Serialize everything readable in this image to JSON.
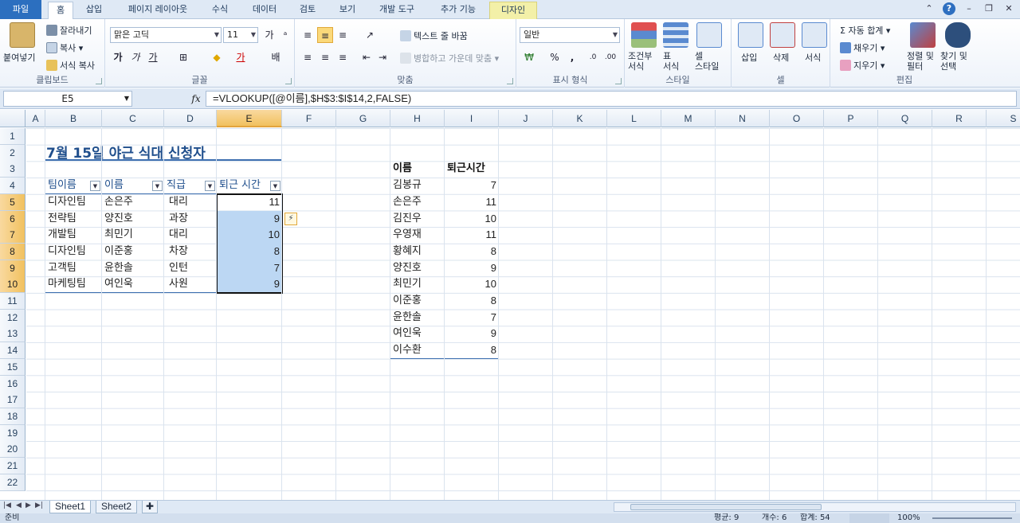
{
  "ribbon": {
    "tabs": [
      "파일",
      "홈",
      "삽입",
      "페이지 레이아웃",
      "수식",
      "데이터",
      "검토",
      "보기",
      "개발 도구",
      "추가 기능",
      "디자인"
    ],
    "clipboard": {
      "paste": "붙여넣기",
      "cut": "잘라내기",
      "copy": "복사",
      "format_painter": "서식 복사",
      "label": "클립보드"
    },
    "font": {
      "name": "맑은 고딕",
      "size": "11",
      "bold": "가",
      "italic": "가",
      "underline": "가",
      "label": "글꼴"
    },
    "alignment": {
      "wrap": "텍스트 줄 바꿈",
      "merge": "병합하고 가운데 맞춤",
      "label": "맞춤"
    },
    "number": {
      "format": "일반",
      "percent": "%",
      "comma": ",",
      "label": "표시 형식"
    },
    "styles": {
      "conditional": "조건부\n서식",
      "table": "표\n서식",
      "cell_style": "셀\n스타일",
      "label": "스타일"
    },
    "cells": {
      "insert": "삽입",
      "delete": "삭제",
      "format": "서식",
      "label": "셀"
    },
    "editing": {
      "autosum": "자동 합계",
      "fill": "채우기",
      "clear": "지우기",
      "sort": "정렬 및\n필터",
      "find": "찾기 및\n선택",
      "label": "편집"
    }
  },
  "formula_bar": {
    "name_box": "E5",
    "fx": "fx",
    "formula": "=VLOOKUP([@이름],$H$3:$I$14,2,FALSE)"
  },
  "columns": [
    "A",
    "B",
    "C",
    "D",
    "E",
    "F",
    "G",
    "H",
    "I",
    "J",
    "K",
    "L",
    "M",
    "N",
    "O",
    "P",
    "Q",
    "R",
    "S"
  ],
  "rows": [
    "1",
    "2",
    "3",
    "4",
    "5",
    "6",
    "7",
    "8",
    "9",
    "10",
    "11",
    "12",
    "13",
    "14",
    "15",
    "16",
    "17",
    "18",
    "19",
    "20",
    "21",
    "22"
  ],
  "sheet": {
    "title": "7월 15일 야근 식대 신청자",
    "table_headers": [
      "팀이름",
      "이름",
      "직급",
      "퇴근 시간"
    ],
    "table_rows": [
      [
        "디자인팀",
        "손은주",
        "대리",
        "11"
      ],
      [
        "전략팀",
        "양진호",
        "과장",
        "9"
      ],
      [
        "개발팀",
        "최민기",
        "대리",
        "10"
      ],
      [
        "디자인팀",
        "이준홍",
        "차장",
        "8"
      ],
      [
        "고객팀",
        "윤한솔",
        "인턴",
        "7"
      ],
      [
        "마케팅팀",
        "여인욱",
        "사원",
        "9"
      ]
    ],
    "lookup_headers": [
      "이름",
      "퇴근시간"
    ],
    "lookup_rows": [
      [
        "김봉규",
        "7"
      ],
      [
        "손은주",
        "11"
      ],
      [
        "김진우",
        "10"
      ],
      [
        "우영재",
        "11"
      ],
      [
        "황혜지",
        "8"
      ],
      [
        "양진호",
        "9"
      ],
      [
        "최민기",
        "10"
      ],
      [
        "이준홍",
        "8"
      ],
      [
        "윤한솔",
        "7"
      ],
      [
        "여인욱",
        "9"
      ],
      [
        "이수환",
        "8"
      ]
    ]
  },
  "sheet_tabs": [
    "Sheet1",
    "Sheet2"
  ],
  "status": {
    "ready": "준비",
    "average": "평균: 9",
    "count": "개수: 6",
    "sum": "합계: 54",
    "zoom": "100%"
  }
}
